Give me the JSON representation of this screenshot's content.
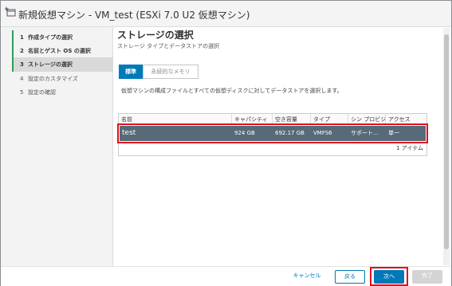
{
  "window": {
    "title": "新規仮想マシン - VM_test (ESXi 7.0 U2 仮想マシン)"
  },
  "wizard": {
    "steps": [
      {
        "num": "1",
        "label": "作成タイプの選択",
        "state": "done"
      },
      {
        "num": "2",
        "label": "名前とゲスト OS の選択",
        "state": "done"
      },
      {
        "num": "3",
        "label": "ストレージの選択",
        "state": "active"
      },
      {
        "num": "4",
        "label": "設定のカスタマイズ",
        "state": "pending"
      },
      {
        "num": "5",
        "label": "設定の確認",
        "state": "pending"
      }
    ]
  },
  "page": {
    "title": "ストレージの選択",
    "subtitle": "ストレージ タイプとデータストアの選択",
    "tabs": [
      "標準",
      "永続的なメモリ"
    ],
    "description": "仮想マシンの構成ファイルとすべての仮想ディスクに対してデータストアを選択します。"
  },
  "grid": {
    "columns": [
      "名前",
      "キャパシティ",
      "空き容量",
      "タイプ",
      "シン プロビジョ",
      "アクセス"
    ],
    "rows": [
      {
        "name": "test",
        "capacity": "924 GB",
        "free": "692.17 GB",
        "type": "VMFS6",
        "thin": "サポート...",
        "access": "単一"
      }
    ],
    "footer": "1 アイテム"
  },
  "buttons": {
    "cancel": "キャンセル",
    "back": "戻る",
    "next": "次へ",
    "finish": "完了"
  },
  "colors": {
    "accent": "#0079b8",
    "selected_row": "#566a78",
    "highlight": "#e0101e",
    "done_marker": "#2e9e58"
  }
}
